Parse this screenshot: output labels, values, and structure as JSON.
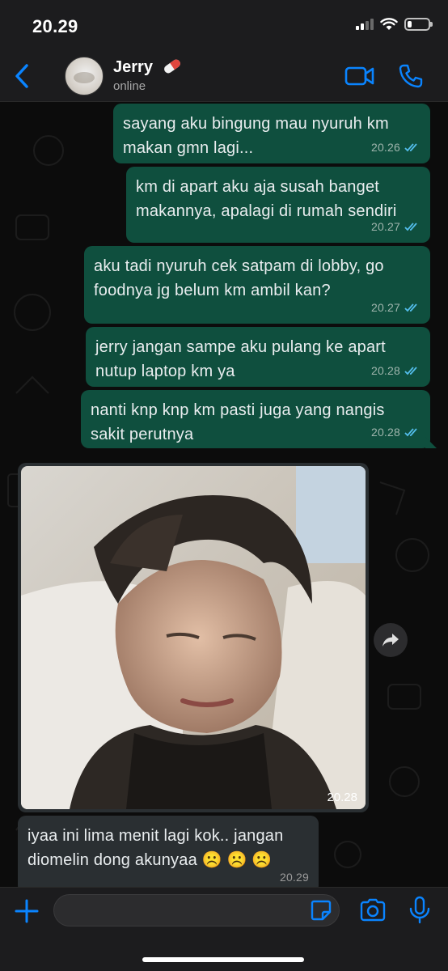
{
  "status_bar": {
    "time": "20.29"
  },
  "header": {
    "contact_name": "Jerry",
    "contact_status": "online",
    "emoji_icon": "pill-emoji"
  },
  "colors": {
    "accent": "#0a84ff",
    "outgoing_bubble": "#0f4f3e",
    "incoming_bubble": "#2a2f32",
    "read_ticks": "#53bdeb"
  },
  "messages": [
    {
      "direction": "out",
      "text": "sayang aku bingung mau nyuruh km makan gmn lagi...",
      "time": "20.26",
      "status": "read"
    },
    {
      "direction": "out",
      "text": "km di apart aku aja susah banget makannya, apalagi di rumah sendiri",
      "time": "20.27",
      "status": "read"
    },
    {
      "direction": "out",
      "text": "aku tadi nyuruh cek satpam di lobby, go foodnya jg belum km ambil kan?",
      "time": "20.27",
      "status": "read"
    },
    {
      "direction": "out",
      "text": "jerry jangan sampe aku pulang ke apart nutup laptop km ya",
      "time": "20.28",
      "status": "read"
    },
    {
      "direction": "out",
      "text": "nanti knp knp km pasti juga yang nangis sakit perutnya",
      "time": "20.28",
      "status": "read"
    },
    {
      "direction": "in",
      "type": "image",
      "time": "20.28"
    },
    {
      "direction": "in",
      "text": "iyaa ini lima menit lagi kok.. jangan diomelin dong akunyaa ☹️ ☹️ ☹️",
      "time": "20.29"
    }
  ],
  "input": {
    "value": "",
    "placeholder": ""
  }
}
